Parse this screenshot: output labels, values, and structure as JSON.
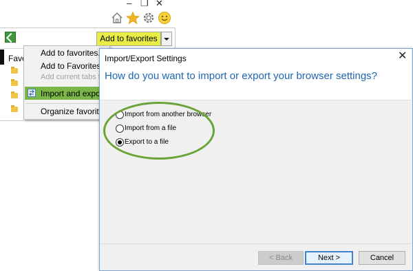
{
  "window_controls": {
    "minimize": "–",
    "restore": "❐",
    "close": "✕"
  },
  "toolbar_icons": [
    "home-icon",
    "star-icon",
    "gear-icon",
    "smiley-icon"
  ],
  "favorites": {
    "add_button": "Add to favorites",
    "tab_label": "Favo"
  },
  "menu": {
    "items": [
      {
        "label": "Add to favorites...",
        "enabled": true
      },
      {
        "label": "Add to Favorites ba",
        "enabled": true
      },
      {
        "label": "Add current tabs to",
        "enabled": false
      },
      {
        "label": "Import and export...",
        "enabled": true,
        "highlighted": true
      },
      {
        "label": "Organize favorites...",
        "enabled": true
      }
    ]
  },
  "dialog": {
    "title": "Import/Export Settings",
    "close": "✕",
    "question": "How do you want to import or export your browser settings?",
    "options": [
      {
        "label": "Import from another browser",
        "selected": false
      },
      {
        "label": "Import from a file",
        "selected": false
      },
      {
        "label": "Export to a file",
        "selected": true
      }
    ],
    "buttons": {
      "back": "< Back",
      "next": "Next >",
      "cancel": "Cancel"
    }
  },
  "colors": {
    "add_button_bg": "#e9ee47",
    "menu_highlight": "#7ab648",
    "question_text": "#1e64b4",
    "annotation_ring": "#6aa337"
  }
}
